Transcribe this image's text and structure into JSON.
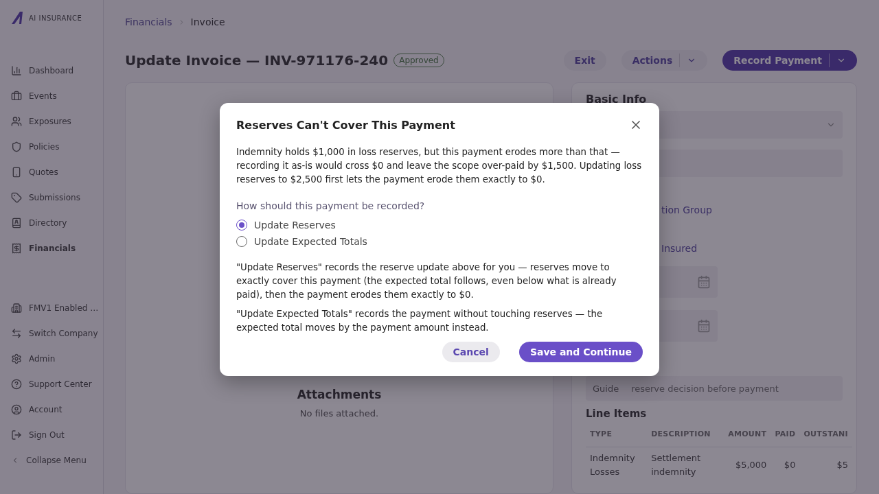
{
  "brand": {
    "name": "AI INSURANCE"
  },
  "sidebar": {
    "items": [
      {
        "label": "Dashboard",
        "selected": false
      },
      {
        "label": "Events",
        "selected": false
      },
      {
        "label": "Exposures",
        "selected": false
      },
      {
        "label": "Policies",
        "selected": false
      },
      {
        "label": "Quotes",
        "selected": false
      },
      {
        "label": "Submissions",
        "selected": false
      },
      {
        "label": "Directory",
        "selected": false
      },
      {
        "label": "Financials",
        "selected": true
      }
    ],
    "footer_items": [
      {
        "label": "FMV1 Enabled …"
      },
      {
        "label": "Switch Company"
      },
      {
        "label": "Admin"
      },
      {
        "label": "Support Center"
      },
      {
        "label": "Account"
      },
      {
        "label": "Sign Out"
      },
      {
        "label": "Collapse Menu"
      }
    ]
  },
  "breadcrumb": [
    {
      "label": "Financials",
      "kind": "link"
    },
    {
      "label": "Invoice",
      "kind": "current"
    }
  ],
  "header": {
    "title": "Update Invoice — INV-971176-240",
    "status": "Approved",
    "buttons": [
      {
        "label": "Exit",
        "kind": "plain"
      },
      {
        "label": "Actions",
        "kind": "split"
      },
      {
        "label": "Record Payment",
        "kind": "primary"
      }
    ]
  },
  "attachments": {
    "title": "Attachments",
    "empty_text": "No files attached."
  },
  "basic_info": {
    "title": "Basic Info",
    "links": [
      "tion Group",
      "Insured"
    ],
    "guide": {
      "label": "Guide",
      "placeholder": "reserve decision before payment"
    }
  },
  "line_items": {
    "title": "Line Items",
    "columns": [
      "TYPE",
      "DESCRIPTION",
      "AMOUNT",
      "PAID",
      "OUTSTANI"
    ],
    "rows": [
      [
        "Indemnity Losses",
        "Settlement indemnity",
        "$5,000",
        "$0",
        "$5"
      ]
    ]
  },
  "dialog": {
    "title": "Reserves Can't Cover This Payment",
    "message": "Indemnity holds $1,000 in loss reserves, but this payment erodes more than that — recording it as-is would cross $0 and leave the scope over-paid by $1,500. Updating loss reserves to $2,500 first lets the payment erode them exactly to $0.",
    "question": "How should this payment be recorded?",
    "options": [
      {
        "label": "Update Reserves",
        "selected": true
      },
      {
        "label": "Update Expected Totals",
        "selected": false
      }
    ],
    "notes": [
      "\"Update Reserves\" records the reserve update above for you — reserves move to exactly cover this payment (the expected total follows, even below what is already paid), then the payment erodes them exactly to $0.",
      "\"Update Expected Totals\" records the payment without touching reserves — the expected total moves by the payment amount instead."
    ],
    "buttons": [
      {
        "label": "Cancel",
        "kind": "secondary"
      },
      {
        "label": "Save and Continue",
        "kind": "primary"
      }
    ]
  }
}
